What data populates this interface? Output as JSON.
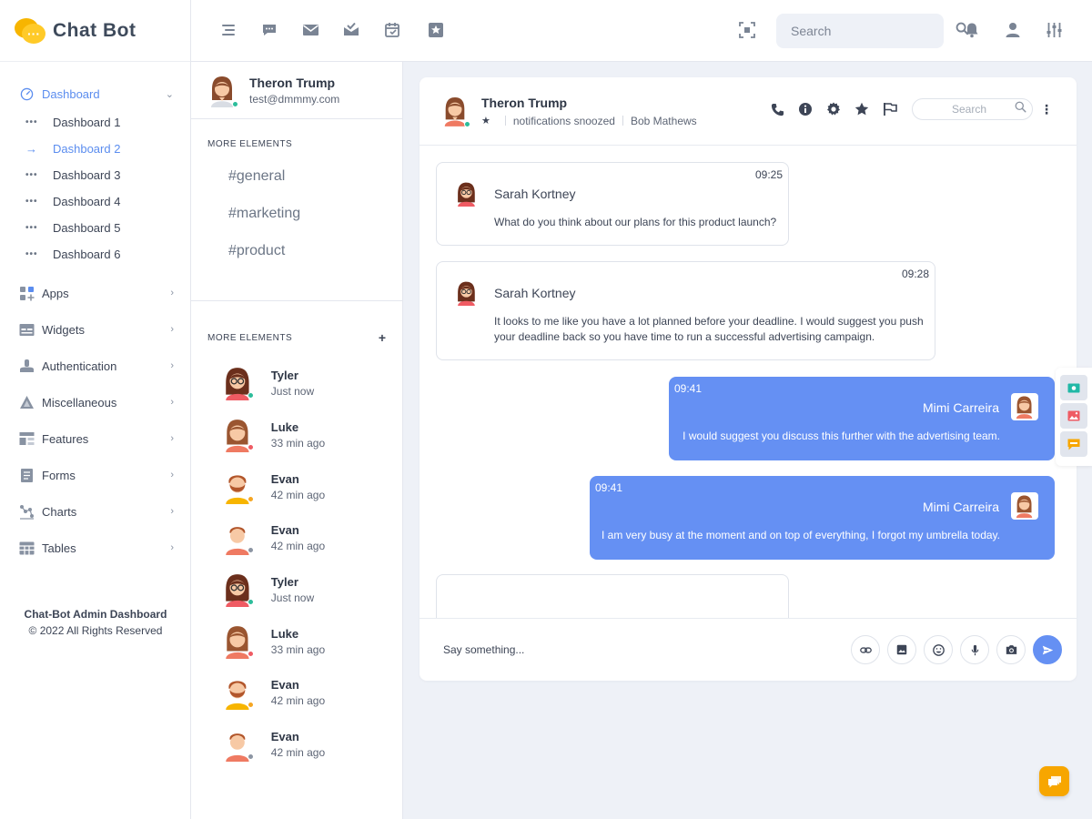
{
  "brand": {
    "name": "Chat Bot"
  },
  "colors": {
    "accent": "#5b8def",
    "bubble_out": "#6590f3",
    "fab": "#f7a600",
    "online": "#2dbd9b",
    "away": "#f5a623",
    "busy": "#ef5b63",
    "offline": "#8c95a3"
  },
  "sidebar": {
    "active": {
      "label": "Dashboard",
      "icon": "dashboard-gauge-icon"
    },
    "subitems": [
      {
        "label": "Dashboard 1",
        "active": false
      },
      {
        "label": "Dashboard 2",
        "active": true
      },
      {
        "label": "Dashboard 3",
        "active": false
      },
      {
        "label": "Dashboard 4",
        "active": false
      },
      {
        "label": "Dashboard 5",
        "active": false
      },
      {
        "label": "Dashboard 6",
        "active": false
      }
    ],
    "items": [
      {
        "label": "Apps",
        "icon": "apps-icon"
      },
      {
        "label": "Widgets",
        "icon": "widgets-icon"
      },
      {
        "label": "Authentication",
        "icon": "authentication-icon"
      },
      {
        "label": "Miscellaneous",
        "icon": "miscellaneous-icon"
      },
      {
        "label": "Features",
        "icon": "features-icon"
      },
      {
        "label": "Forms",
        "icon": "forms-icon"
      },
      {
        "label": "Charts",
        "icon": "charts-icon"
      },
      {
        "label": "Tables",
        "icon": "tables-icon"
      }
    ],
    "footer": {
      "line1": "Chat-Bot Admin Dashboard",
      "line2": "© 2022 All Rights Reserved"
    }
  },
  "topbar": {
    "search_placeholder": "Search",
    "icons": [
      "menu-toggle-icon",
      "chat-icon",
      "mail-icon",
      "inbox-check-icon",
      "calendar-icon",
      "star-box-icon",
      "fullscreen-icon",
      "search-icon",
      "bell-icon",
      "user-icon",
      "settings-sliders-icon"
    ]
  },
  "profile": {
    "name": "Theron Trump",
    "email": "test@dmmmy.com"
  },
  "channels": {
    "title": "More Elements",
    "list": [
      "#general",
      "#marketing",
      "#product"
    ]
  },
  "people": {
    "title": "More Elements",
    "list": [
      {
        "name": "Tyler",
        "time": "Just now",
        "status": "online",
        "avatar": "glasses-woman"
      },
      {
        "name": "Luke",
        "time": "33 min ago",
        "status": "busy",
        "avatar": "woman"
      },
      {
        "name": "Evan",
        "time": "42 min ago",
        "status": "away",
        "avatar": "beard-man"
      },
      {
        "name": "Evan",
        "time": "42 min ago",
        "status": "offline",
        "avatar": "young-man"
      },
      {
        "name": "Tyler",
        "time": "Just now",
        "status": "online",
        "avatar": "glasses-woman"
      },
      {
        "name": "Luke",
        "time": "33 min ago",
        "status": "busy",
        "avatar": "woman"
      },
      {
        "name": "Evan",
        "time": "42 min ago",
        "status": "away",
        "avatar": "beard-man"
      },
      {
        "name": "Evan",
        "time": "42 min ago",
        "status": "offline",
        "avatar": "young-man"
      }
    ]
  },
  "chat": {
    "header": {
      "name": "Theron Trump",
      "status": "notifications snoozed",
      "assignee": "Bob Mathews",
      "search_placeholder": "Search"
    },
    "messages": [
      {
        "dir": "in",
        "time": "09:25",
        "sender": "Sarah Kortney",
        "text": "What do you think about our plans for this product launch?"
      },
      {
        "dir": "in",
        "time": "09:28",
        "sender": "Sarah Kortney",
        "text": "It looks to me like you have a lot planned before your deadline. I would suggest you push your deadline back so you have time to run a successful advertising campaign."
      },
      {
        "dir": "out",
        "time": "09:41",
        "sender": "Mimi Carreira",
        "text": "I would suggest you discuss this further with the advertising team."
      },
      {
        "dir": "out",
        "time": "09:41",
        "sender": "Mimi Carreira",
        "text": "I am very busy at the moment and on top of everything, I forgot my umbrella today."
      }
    ],
    "composer": {
      "placeholder": "Say something...",
      "buttons": [
        "attach-link-icon",
        "image-icon",
        "emoji-icon",
        "microphone-icon",
        "camera-icon",
        "send-icon"
      ]
    }
  }
}
